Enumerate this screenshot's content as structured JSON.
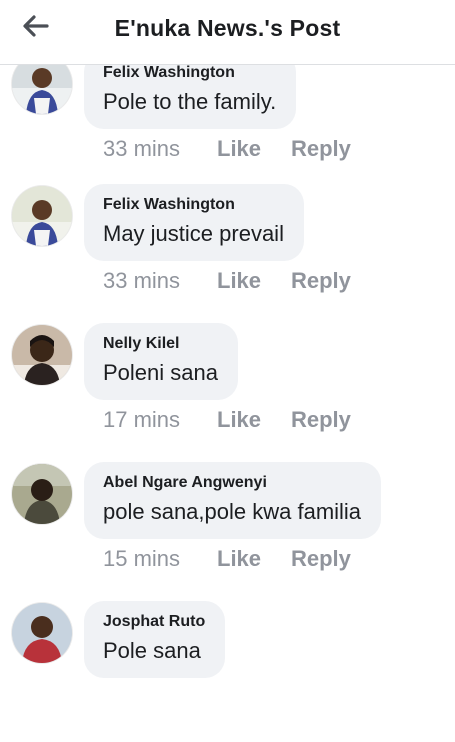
{
  "header": {
    "title": "E'nuka News.'s Post",
    "back_icon": "arrow-left-icon"
  },
  "actions": {
    "like_label": "Like",
    "reply_label": "Reply"
  },
  "comments": [
    {
      "author": "Felix Washington",
      "text": "Pole to the family.",
      "time": "33 mins"
    },
    {
      "author": "Felix Washington",
      "text": "May justice prevail",
      "time": "33 mins"
    },
    {
      "author": "Nelly Kilel",
      "text": "Poleni sana",
      "time": "17 mins"
    },
    {
      "author": "Abel Ngare Angwenyi",
      "text": "pole sana,pole kwa familia",
      "time": "15 mins"
    },
    {
      "author": "Josphat Ruto",
      "text": "Pole sana",
      "time": ""
    }
  ],
  "colors": {
    "bubble": "#f0f2f5",
    "meta_text": "#90949c",
    "text": "#1c1e21"
  }
}
